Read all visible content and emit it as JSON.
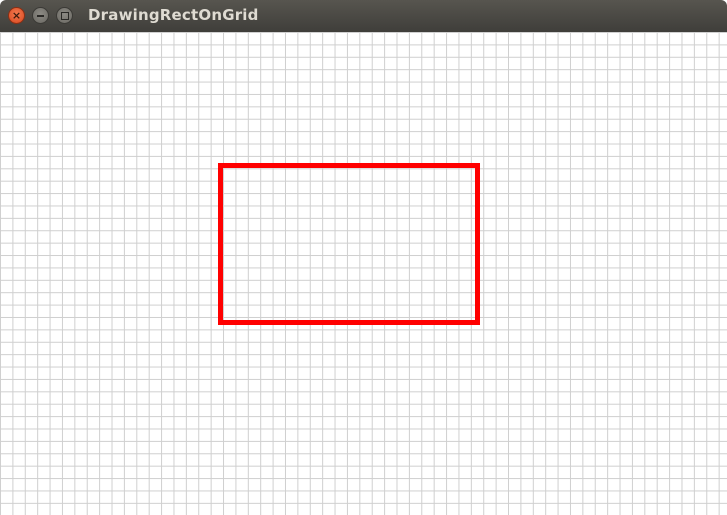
{
  "window": {
    "title": "DrawingRectOnGrid",
    "buttons": {
      "close_glyph": "×",
      "minimize_icon": "minimize-icon",
      "maximize_icon": "maximize-icon"
    }
  },
  "canvas": {
    "grid_color": "#cfcfcf",
    "background_color": "#ffffff",
    "rectangle": {
      "stroke_color": "#ff0000",
      "fill": "none"
    }
  }
}
